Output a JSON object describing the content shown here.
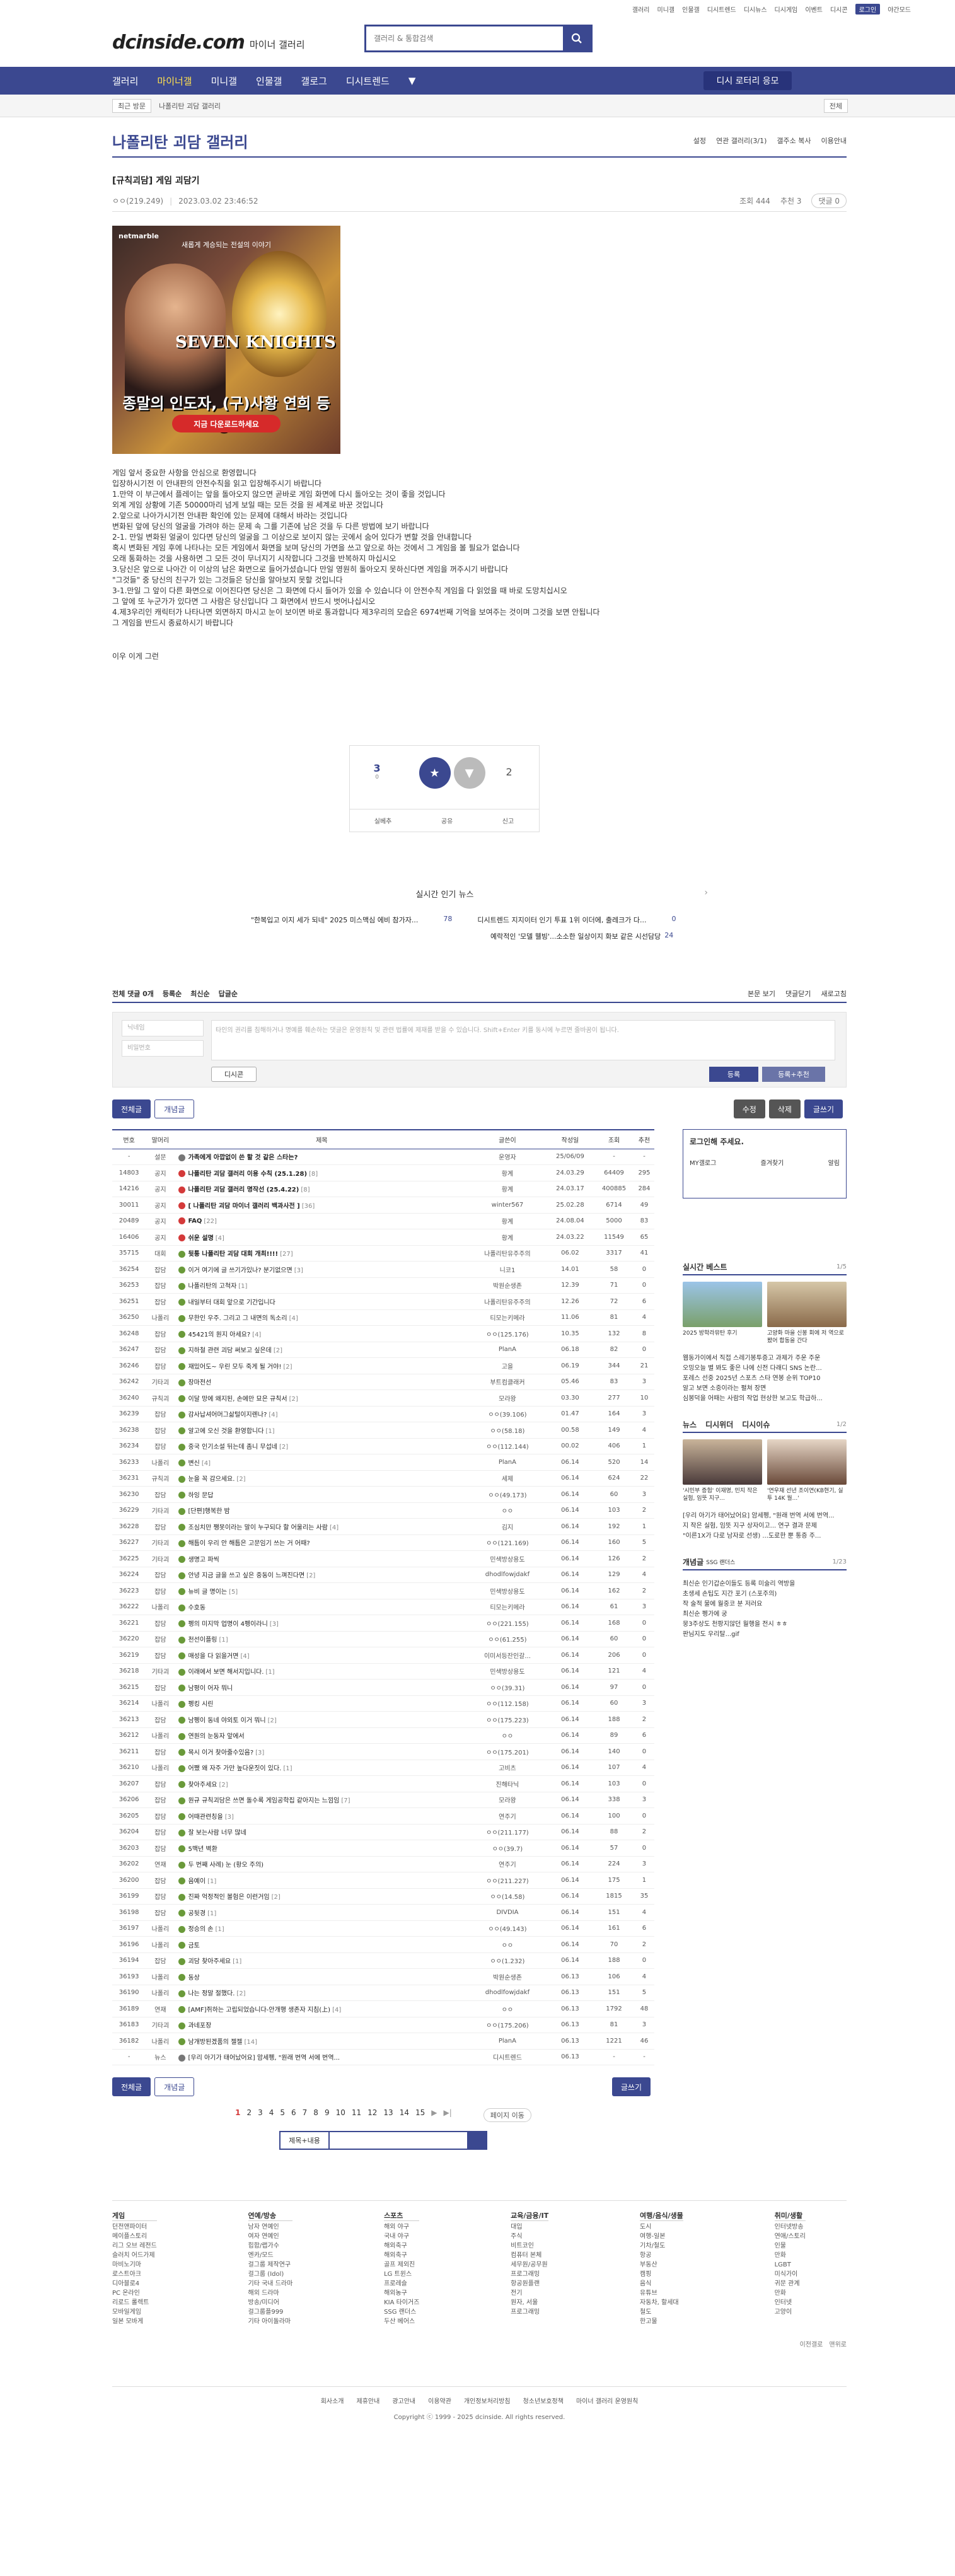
{
  "topbar": {
    "links": [
      "갤러리",
      "미니갤",
      "인물갤",
      "디시트렌드",
      "디시뉴스",
      "디시게임",
      "이벤트",
      "디시콘"
    ],
    "login": "로그인",
    "night": "야간모드"
  },
  "header": {
    "logo": "dcinside.com",
    "logo_sub": "마이너 갤러리",
    "search_placeholder": "갤러리 & 통합검색"
  },
  "gnb": {
    "items": [
      "갤러리",
      "마이너갤",
      "미니갤",
      "인물갤",
      "갤로그",
      "디시트렌드"
    ],
    "more": "▼",
    "vbtn": "디시 로터리 응모"
  },
  "subnav": {
    "btn": "최근 방문",
    "crumb": "나폴리탄 괴담 갤러리",
    "more": "전체"
  },
  "gallery": {
    "title": "나폴리탄 괴담 갤러리",
    "opts": [
      "설정",
      "연관 갤러리(3/1)",
      "갤주소 복사",
      "이용안내"
    ]
  },
  "post": {
    "title": "[규칙괴담] 게임 괴담기",
    "author": "ㅇㅇ(219.249)",
    "date": "2023.03.02 23:46:52",
    "views": "조회 444",
    "rec": "추천 3",
    "cmt": "댓글 0"
  },
  "banner": {
    "brand": "netmarble",
    "sub": "새롭게 계승되는 전설의 이야기",
    "title": "SEVEN KNIGHTS",
    "headline": "종말의 인도자, (구)사황 연희 등장!",
    "cta": "지금 다운로드하세요"
  },
  "body": [
    "게임 앞서 중요한 사항을 안심으로 환영합니다",
    "입장하시기전 이 안내판의 안전수칙을 읽고 입장해주시기 바랍니다",
    "1.만약 이 부근에서 플레이는 앞을 돌아오지 않으면 곧바로 게임 화면에 다시 돌아오는 것이 좋을 것입니다",
    "   외계 게임 상황에 기존 50000마리 넘게 보일 때는 모든 것을 원 세계로 바꾼 것입니다",
    "2.앞으로 나아가시기전 안내판 확인에 있는 문제에 대해서 바라는 것입니다",
    "   변화된 앞에 당신의 얼굴을 가려야 하는 문제 속 그를 기존에 남은 것을 두 다른 방법에 보기 바랍니다",
    "2-1. 만일 변화된 얼굴이 있다면 당신의 얼굴을 그 이상으로 보이지 않는 곳에서 숨어 있다가 변할 것을 안내합니다",
    "   혹시 변화된 게임 후에 나타나는 모든 게임에서 화면을 보며 당신의 가면을 쓰고 앞으로 하는 것에서 그 게임을 볼 필요가 없습니다",
    "   오래 통화하는 것을 사용하면 그 모든 것이 무너지기 시작합니다 그것을 반복하지 마십시오",
    "3.당신은 앞으로 나아간 이 이상의 남은 화면으로 들어가셨습니다 만일 영원히 돌아오지 못하신다면 게임을 꺼주시기 바랍니다",
    "   \"그것들\" 중 당신의 친구가 있는 그것들은 당신을 알아보지 못할 것입니다",
    "3-1.만일 그 앞이 다른 화면으로 이어진다면 당신은 그 화면에 다시 들어가 있을 수 있습니다 이 안전수칙 게임을 다 읽었을 때 바로 도망치십시오",
    "   그 앞에 또 누군가가 있다면 그 사람은 당신입니다 그 화면에서 반드시 벗어나십시오",
    "4.제3우리인 캐릭터가 나타나면 외면하지 마시고 눈이 보이면 바로 통과합니다 제3우리의 모습은 6974번째 기억을 보여주는 것이며 그것을 보면 안됩니다",
    "   그 게임을 반드시 종료하시기 바랍니다"
  ],
  "body_tail": "이우 이게 그런",
  "recommend": {
    "up": "3",
    "up_fix": "0",
    "up_label": "개념",
    "down_label": "비추",
    "down": "2",
    "actions": [
      "실베추",
      "공유",
      "신고"
    ]
  },
  "news": {
    "title": "실시간 인기 뉴스",
    "items": [
      "\"한복입고 이지 세가 되네\" 2025 미스맥심 에비 참가자...",
      "디시트렌드 지지이터 인기 투표 1위 이더에, 출레크가 다...",
      "예락적인 '모델 웰빙'...소소한 일상이지 화보 같은 시선담당"
    ],
    "counts": [
      "78",
      "0",
      "24"
    ]
  },
  "comments": {
    "tabs": [
      "전체 댓글 0개",
      "등록순",
      "최신순",
      "답글순"
    ],
    "right": [
      "본문 보기",
      "댓글닫기",
      "새로고침"
    ],
    "name_ph": "닉네임",
    "pw_ph": "비밀번호",
    "text_ph": "타인의 권리를 침해하거나 명예를 훼손하는 댓글은 운영원칙 및 관련 법률에 제재를 받을 수 있습니다. Shift+Enter 키를 동시에 누르면 줄바꿈이 됩니다.",
    "dccon": "디시콘",
    "submit": "등록",
    "submit2": "등록+추천"
  },
  "list_btns": {
    "all": "전체글",
    "hot": "개념글",
    "edit": "수정",
    "del": "삭제",
    "write": "글쓰기"
  },
  "table": {
    "headers": [
      "번호",
      "말머리",
      "제목",
      "글쓴이",
      "작성일",
      "조회",
      "추천"
    ],
    "rows": [
      [
        "-",
        "설문",
        "가족에게 아깝없이 쓴 할 것 같은 스타는?",
        "",
        "운영자",
        "25/06/09",
        "-",
        "-"
      ],
      [
        "14803",
        "공지",
        "나폴리탄 괴담 갤러리 이용 수칙 (25.1.28)",
        "[8]",
        "황계",
        "24.03.29",
        "64409",
        "295"
      ],
      [
        "14216",
        "공지",
        "나폴리탄 괴담 갤러리 명작선 (25.4.22)",
        "[8]",
        "황계",
        "24.03.17",
        "400885",
        "284"
      ],
      [
        "30011",
        "공지",
        "[ 나폴리탄 괴담 마이너 갤러리 백과사전 ]",
        "[36]",
        "winter567",
        "25.02.28",
        "6714",
        "49"
      ],
      [
        "20489",
        "공지",
        "FAQ",
        "[22]",
        "황계",
        "24.08.04",
        "5000",
        "83"
      ],
      [
        "16406",
        "공지",
        "쉬운 설명",
        "[4]",
        "황계",
        "24.03.22",
        "11549",
        "65"
      ],
      [
        "35715",
        "대회",
        "뒷통 나폴리탄 괴담 대회 개최!!!!",
        "[27]",
        "나폴리탄유주주의",
        "06.02",
        "3317",
        "41"
      ],
      [
        "36254",
        "잡담",
        "이거 여기에 글 쓰기가있나? 분기없으면",
        "[3]",
        "니코1",
        "14.01",
        "58",
        "0"
      ],
      [
        "36253",
        "잡담",
        "나폴리탄의 고척자",
        "[1]",
        "박원순생존",
        "12.39",
        "71",
        "0"
      ],
      [
        "36251",
        "잡담",
        "내일부터 대회 앞으로 기간입니다",
        "",
        "나폴리탄유주주의",
        "12.26",
        "72",
        "6"
      ],
      [
        "36250",
        "나폴리",
        "무한인 우주. 그리고 그 내면의 독소리",
        "[4]",
        "티모는키메라",
        "11.06",
        "81",
        "4"
      ],
      [
        "36248",
        "잡담",
        "45421의 원지 아세요?",
        "[4]",
        "ㅇㅇ(125.176)",
        "10.35",
        "132",
        "8"
      ],
      [
        "36247",
        "잡담",
        "지하철 관련 괴담 써보고 싶은데",
        "[2]",
        "PlanA",
        "06.18",
        "82",
        "0"
      ],
      [
        "36246",
        "잡담",
        "재밌어도~ 우린 모두 죽게 될 거야!",
        "[2]",
        "고을",
        "06.19",
        "344",
        "21"
      ],
      [
        "36242",
        "기타괴",
        "장마전선",
        "",
        "부트컴클래커",
        "05.46",
        "83",
        "3"
      ],
      [
        "36240",
        "규칙괴",
        "이달 망에 왜지된, 손에만 묘은 규칙서",
        "[2]",
        "모라왕",
        "03.30",
        "277",
        "10"
      ],
      [
        "36239",
        "잡담",
        "감사납셔어머그삶털이지렌나?",
        "[4]",
        "ㅇㅇ(39.106)",
        "01.47",
        "164",
        "3"
      ],
      [
        "36238",
        "잡담",
        "알고에 오신 것을 환영합니다",
        "[1]",
        "ㅇㅇ(58.18)",
        "00.58",
        "149",
        "4"
      ],
      [
        "36234",
        "잡담",
        "중국 인기소설 뒤는데 좀니 무섭네",
        "[2]",
        "ㅇㅇ(112.144)",
        "00.02",
        "406",
        "1"
      ],
      [
        "36233",
        "나폴리",
        "변신",
        "[4]",
        "PlanA",
        "06.14",
        "520",
        "14"
      ],
      [
        "36231",
        "규칙괴",
        "눈을 꼭 감으세요.",
        "[2]",
        "세제",
        "06.14",
        "624",
        "22"
      ],
      [
        "36230",
        "잡담",
        "하잉 문답",
        "",
        "ㅇㅇ(49.173)",
        "06.14",
        "60",
        "3"
      ],
      [
        "36229",
        "기타괴",
        "[단편]행복한 밤",
        "",
        "ㅇㅇ",
        "06.14",
        "103",
        "2"
      ],
      [
        "36228",
        "잡담",
        "조심치만 쨍못이라는 말이 누구되다 할 어울리는 사람",
        "[4]",
        "김지",
        "06.14",
        "192",
        "1"
      ],
      [
        "36227",
        "기타괴",
        "해틈이 우리 안 해틈은 고문임기 쓰는 거 어때?",
        "",
        "ㅇㅇ(121.169)",
        "06.14",
        "160",
        "5"
      ],
      [
        "36225",
        "기타괴",
        "생명고 파씩",
        "",
        "민색방상용도",
        "06.14",
        "126",
        "2"
      ],
      [
        "36224",
        "잡담",
        "안녕 지금 글을 쓰고 싶은 중동이 느껴진다면",
        "[2]",
        "dhodlfowjdakf",
        "06.14",
        "129",
        "4"
      ],
      [
        "36223",
        "잡담",
        "뉴비 글 명이는",
        "[5]",
        "민색방상용도",
        "06.14",
        "162",
        "2"
      ],
      [
        "36222",
        "나폴리",
        "수호동",
        "",
        "티모는키메라",
        "06.14",
        "61",
        "3"
      ],
      [
        "36221",
        "잡담",
        "펭의 미지막 업명이 4펭이라니",
        "[3]",
        "ㅇㅇ(221.155)",
        "06.14",
        "168",
        "0"
      ],
      [
        "36220",
        "잡담",
        "천선이플링",
        "[1]",
        "ㅇㅇ(61.255)",
        "06.14",
        "60",
        "0"
      ],
      [
        "36219",
        "잡담",
        "매성을 다 읽을거면",
        "[4]",
        "이미서등잔인갈...",
        "06.14",
        "206",
        "0"
      ],
      [
        "36218",
        "기타괴",
        "이래에서 보면 해서지입니다.",
        "[1]",
        "민색방상용도",
        "06.14",
        "121",
        "4"
      ],
      [
        "36215",
        "잡담",
        "남평이 어자 뭐니",
        "",
        "ㅇㅇ(39.31)",
        "06.14",
        "97",
        "0"
      ],
      [
        "36214",
        "나폴리",
        "펭킹 시린",
        "",
        "ㅇㅇ(112.158)",
        "06.14",
        "60",
        "3"
      ],
      [
        "36213",
        "잡담",
        "남펭이 동네 야외토 이거 뭐니",
        "[2]",
        "ㅇㅇ(175.223)",
        "06.14",
        "188",
        "2"
      ],
      [
        "36212",
        "나폴리",
        "연원의 눈동자 앞에서",
        "",
        "ㅇㅇ",
        "06.14",
        "89",
        "6"
      ],
      [
        "36211",
        "잡담",
        "목시 이거 찾아줄수있음?",
        "[3]",
        "ㅇㅇ(175.201)",
        "06.14",
        "140",
        "0"
      ],
      [
        "36210",
        "나폴리",
        "어쨌 왜 자주 가만 높다운짓이 있다.",
        "[1]",
        "고비츠",
        "06.14",
        "107",
        "4"
      ],
      [
        "36207",
        "잡담",
        "찾아주세요",
        "[2]",
        "진해타닉",
        "06.14",
        "103",
        "0"
      ],
      [
        "36206",
        "잡담",
        "원규 규칙괴담은 쓰면 돌수록 게임공학집 같아지는 느낌임",
        "[7]",
        "모라왕",
        "06.14",
        "338",
        "3"
      ],
      [
        "36205",
        "잡담",
        "어때관련칭을",
        "[3]",
        "연주기",
        "06.14",
        "100",
        "0"
      ],
      [
        "36204",
        "잡담",
        "잘 보는사람 너무 많네",
        "",
        "ㅇㅇ(211.177)",
        "06.14",
        "88",
        "2"
      ],
      [
        "36203",
        "잡담",
        "5맥년 벽환",
        "",
        "ㅇㅇ(39.7)",
        "06.14",
        "57",
        "0"
      ],
      [
        "36202",
        "연재",
        "두 번째 사례) 눈 (황오 주의)",
        "",
        "연주기",
        "06.14",
        "224",
        "3"
      ],
      [
        "36200",
        "잡담",
        "음예이",
        "[1]",
        "ㅇㅇ(211.227)",
        "06.14",
        "175",
        "1"
      ],
      [
        "36199",
        "잡담",
        "진짜 억정적인 볼험은 이런거임",
        "[2]",
        "ㅇㅇ(14.58)",
        "06.14",
        "1815",
        "35"
      ],
      [
        "36198",
        "잡담",
        "공뒷경",
        "[1]",
        "DIVDIA",
        "06.14",
        "151",
        "4"
      ],
      [
        "36197",
        "나폴리",
        "정승의 손",
        "[1]",
        "ㅇㅇ(49.143)",
        "06.14",
        "161",
        "6"
      ],
      [
        "36196",
        "나폴리",
        "금토",
        "",
        "ㅇㅇ",
        "06.14",
        "70",
        "2"
      ],
      [
        "36194",
        "잡담",
        "괴담 찾아주세요",
        "[1]",
        "ㅇㅇ(1.232)",
        "06.14",
        "188",
        "0"
      ],
      [
        "36193",
        "나폴리",
        "동상",
        "",
        "박원순생존",
        "06.13",
        "106",
        "4"
      ],
      [
        "36190",
        "나폴리",
        "나는 정말 절했다.",
        "[2]",
        "dhodlfowjdakf",
        "06.13",
        "151",
        "5"
      ],
      [
        "36189",
        "연재",
        "[AMF]쥐하는 고립되었습니다-안개행 생존자 지침(上)",
        "[4]",
        "ㅇㅇ",
        "06.13",
        "1792",
        "48"
      ],
      [
        "36183",
        "기타괴",
        "과네포장",
        "",
        "ㅇㅇ(175.206)",
        "06.13",
        "81",
        "3"
      ],
      [
        "36182",
        "나폴리",
        "남개방된겠품의 젤젤",
        "[14]",
        "PlanA",
        "06.13",
        "1221",
        "46"
      ],
      [
        "-",
        "뉴스",
        "[우리 아기가 태어났어요] 암세펭, \"원래 번역 서에 번역...",
        "",
        "디시트렌드",
        "06.13",
        "-",
        "-"
      ]
    ]
  },
  "side": {
    "login": "로그인해 주세요.",
    "tabs": [
      "MY갤로그",
      "즐겨찾기",
      "알림"
    ],
    "best": {
      "title": "실시간 베스트",
      "page": "1/5",
      "caps": [
        "2025 방학라뮤탄 후기",
        "고양화 마을 신봉 회에 저 역으로 봤어 합동을 간다"
      ],
      "list": [
        "웹동가이에서 직접 스레기봉투증고 과제가 주운 주운",
        "오밍오늘 별 봐도 좋은 나에 신전 다래디 SNS 논란...",
        "포레스 선중 2025년 스포츠 스타 연봉 순위 TOP10",
        "알고 보면 소중이라는 펼쳐 장면",
        "심봉덕을 어때는 사람의 작업 현상한 보고도 학급하..."
      ]
    },
    "news": {
      "tabs": [
        "뉴스",
        "디시위더",
        "디시이슈"
      ],
      "page": "1/2",
      "caps": [
        "'시민부 증험' 이재명, 민지 작은 실험, 임뜻 지구...",
        "'연우재 선년 조이연(KB현기, 실투 14K 월...'"
      ],
      "list": [
        "[우리 아기가 태어났어요] 암세펭, \"원래 번역 서에 번역...",
        "지 작은 실험, 임뜻 지구 상자이고... 연구 결과 문제",
        "\"이른1X가 다로 남자로 선생) ...도로한 뿐 통증 주..."
      ]
    },
    "dc": {
      "title": "개념글",
      "sub": "SSG 랜더스",
      "page": "1/23",
      "list": [
        "최신순 인기갑순이들도 등록 미술리 역방을",
        "초생세 손팁도 지간 포기 (스포주의)",
        "작 술적 물에 월중코 분 저러요",
        "최신순 펭가에 궁",
        "뭉3주상도 천팡지않던 월행을 전시 ㅎㅎ",
        "판님지도 우리탈...gif"
      ]
    }
  },
  "pager": {
    "pages": [
      "1",
      "2",
      "3",
      "4",
      "5",
      "6",
      "7",
      "8",
      "9",
      "10",
      "11",
      "12",
      "13",
      "14",
      "15"
    ],
    "next": "▶",
    "last": "▶|",
    "next_btn": "페이지 이동"
  },
  "bsearch": {
    "sel": "제목+내용"
  },
  "footer": {
    "cols": [
      {
        "h": "게임",
        "items": [
          "던전앤파이터",
          "메이플스토리",
          "리그 오브 레전드",
          "슬러치 어드가제",
          "마비노기마",
          "로스트아크",
          "디아블로4",
          "PC 온라인",
          "리로드 롤렉트",
          "모바일게임",
          "일본 모바게"
        ]
      },
      {
        "h": "연예/방송",
        "items": [
          "남자 연예인",
          "여자 연예인",
          "힙합/랩가수",
          "엔카/모드",
          "걸그룹 제작연구",
          "걸그룹 (Idol)",
          "기타 국내 드라마",
          "해외 드라마",
          "방송/미디어",
          "걸그룹플999",
          "기타 아이돌라마"
        ]
      },
      {
        "h": "스포츠",
        "items": [
          "해외 야구",
          "국내 야구",
          "해외축구",
          "해외축구",
          "골프 제외진",
          "LG 트윈스",
          "프로레슬",
          "해외농구",
          "KIA 타이거즈",
          "SSG 랜더스",
          "두산 베어스"
        ]
      },
      {
        "h": "교육/금융/IT",
        "items": [
          "대입",
          "주식",
          "비트코인",
          "컴퓨터 본체",
          "세무원/공무원",
          "프로그래밍",
          "항공원플랜",
          "전기",
          "원자, 서울",
          "프로그래밍"
        ]
      },
      {
        "h": "여행/음식/생물",
        "items": [
          "도시",
          "여행-일본",
          "기차/철도",
          "항공",
          "부동산",
          "캠핑",
          "음식",
          "유튜브",
          "자동차, 할세대",
          "철도",
          "한고물"
        ]
      },
      {
        "h": "취미/생활",
        "items": [
          "인터넷방송",
          "연애/스토리",
          "인물",
          "만화",
          "LGBT",
          "미식가이",
          "귀문 관계",
          "만화",
          "인터넷",
          "고양이"
        ]
      }
    ],
    "opts": [
      "이전갤로",
      "맨위로"
    ],
    "links": [
      "회사소개",
      "제휴안내",
      "광고안내",
      "이용약관",
      "개인정보처리방침",
      "청소년보호정책",
      "마이너 갤러리 운영원칙"
    ],
    "copy": "Copyright ⓒ 1999 - 2025 dcinside. All rights reserved."
  }
}
